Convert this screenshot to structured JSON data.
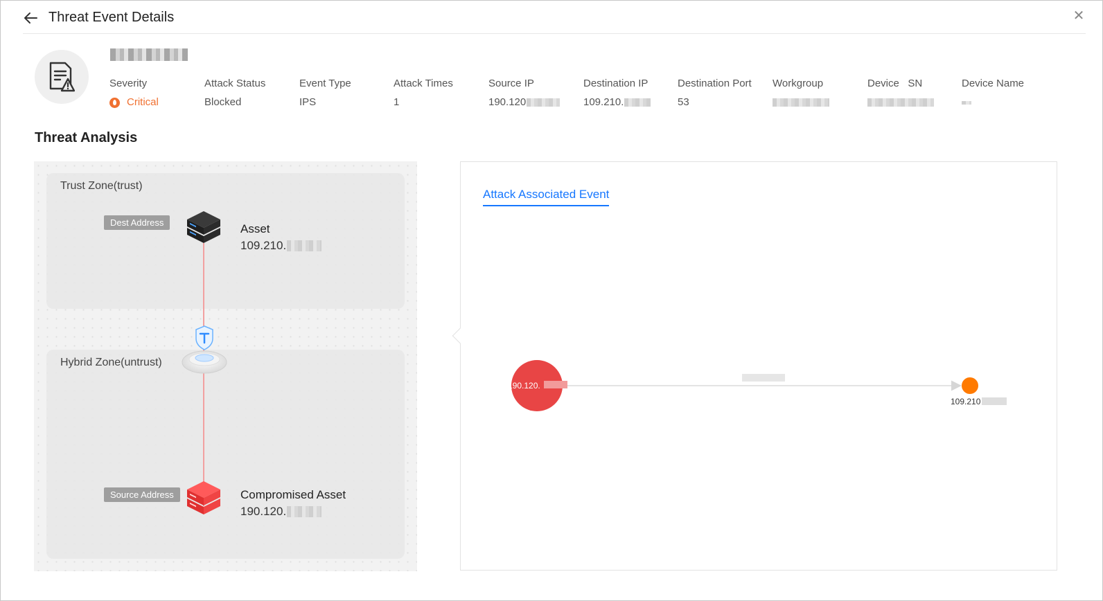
{
  "header": {
    "title": "Threat Event Details"
  },
  "event": {
    "fields": [
      {
        "label": "Severity",
        "value": "Critical"
      },
      {
        "label": "Attack Status",
        "value": "Blocked"
      },
      {
        "label": "Event Type",
        "value": "IPS"
      },
      {
        "label": "Attack Times",
        "value": "1"
      },
      {
        "label": "Source IP",
        "value": "190.120"
      },
      {
        "label": "Destination IP",
        "value": "109.210."
      },
      {
        "label": "Destination Port",
        "value": "53"
      },
      {
        "label": "Workgroup",
        "value": ""
      },
      {
        "label": "Device   SN",
        "value": ""
      },
      {
        "label": "Device Name",
        "value": ""
      }
    ]
  },
  "analysis": {
    "section_title": "Threat Analysis",
    "trust_zone": "Trust Zone(trust)",
    "hybrid_zone": "Hybrid Zone(untrust)",
    "dest": {
      "tag": "Dest Address",
      "title": "Asset",
      "ip": "109.210."
    },
    "source": {
      "tag": "Source Address",
      "title": "Compromised Asset",
      "ip": "190.120."
    }
  },
  "associated": {
    "tab_label": "Attack Associated Event",
    "source_node": "190.120.",
    "target_node": "109.210",
    "colors": {
      "source": "#e84545",
      "target": "#ff7a00",
      "tab": "#1677ff"
    }
  }
}
